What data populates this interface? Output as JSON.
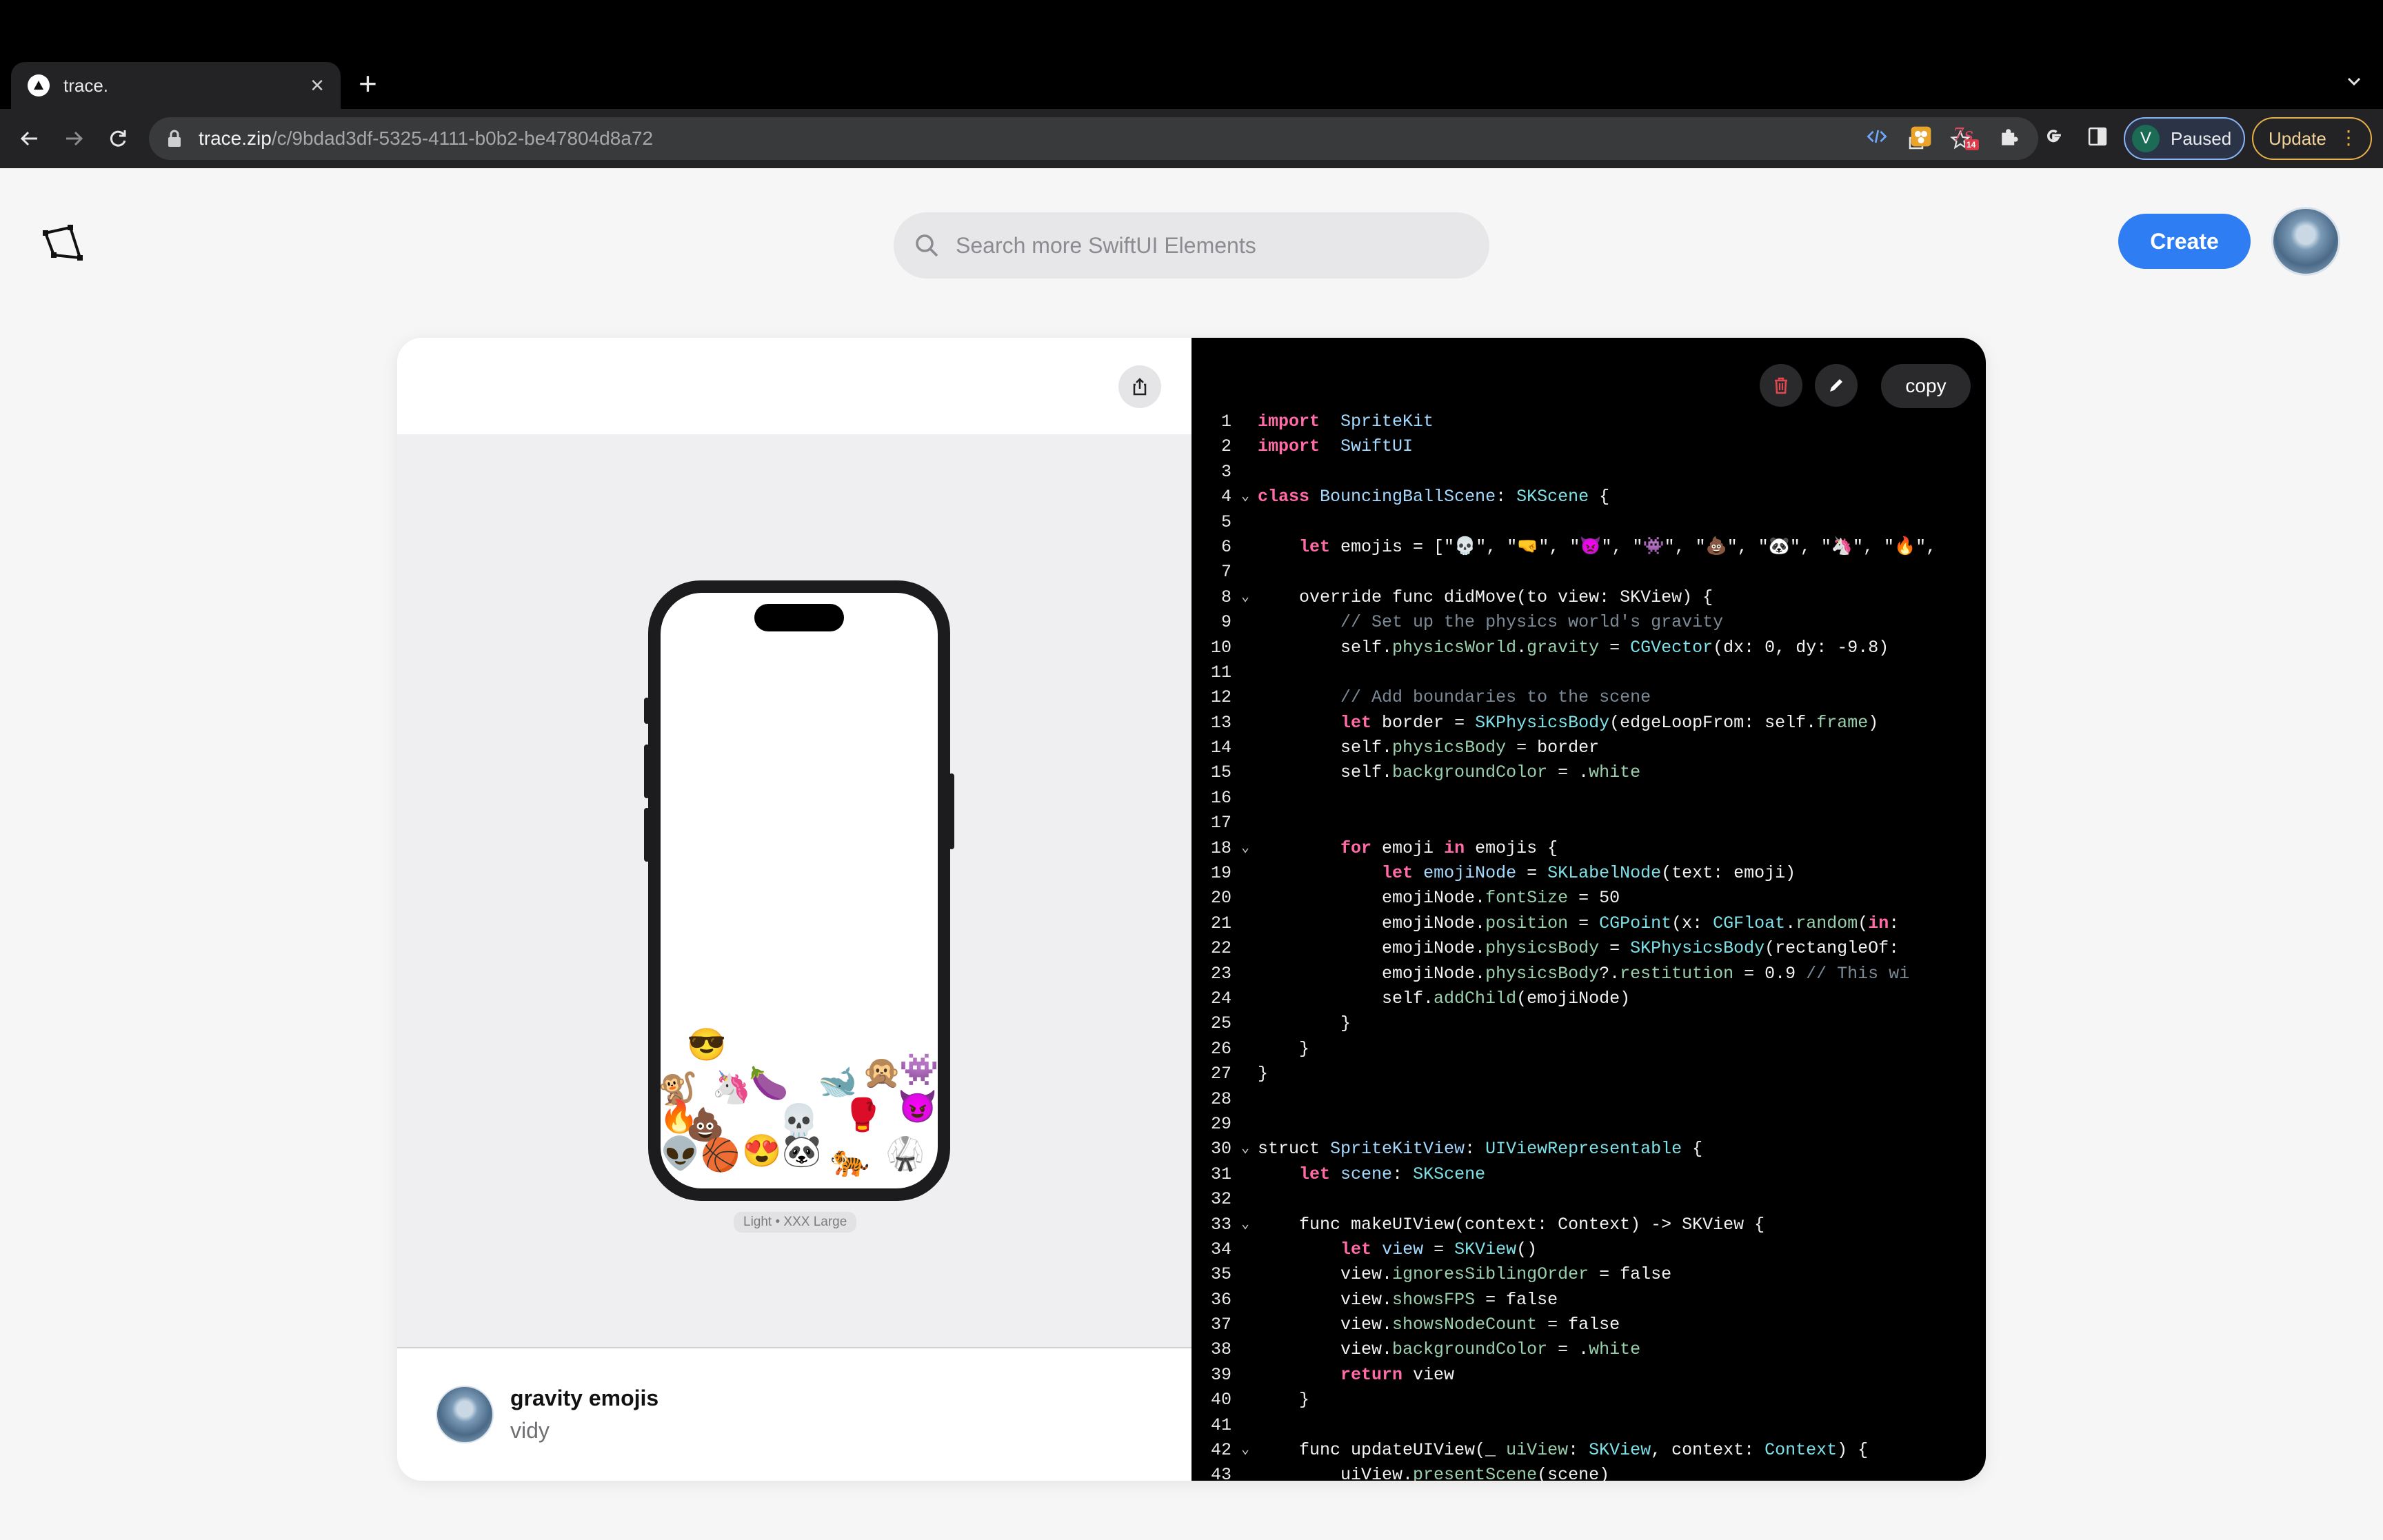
{
  "browser": {
    "tab_title": "trace.",
    "url_host": "trace.zip",
    "url_path": "/c/9bdad3df-5325-4111-b0b2-be47804d8a72",
    "profile_initial": "V",
    "profile_status": "Paused",
    "update_label": "Update",
    "extension_badge": "14"
  },
  "header": {
    "search_placeholder": "Search more SwiftUI Elements",
    "create_label": "Create"
  },
  "preview": {
    "variant_label": "Light • XXX Large",
    "emojis": [
      "😎",
      "🐒",
      "🦄",
      "🍆",
      "💀",
      "🐋",
      "🙊",
      "👾",
      "🔥",
      "💩",
      "🥊",
      "😈",
      "👽",
      "🏀",
      "😍",
      "🐼",
      "🐅",
      "🥋"
    ]
  },
  "element": {
    "title": "gravity emojis",
    "author": "vidy"
  },
  "code": {
    "copy_label": "copy",
    "lines": [
      {
        "n": "1",
        "fold": "",
        "t": [
          [
            "kw",
            "import"
          ],
          [
            "",
            "  "
          ],
          [
            "ty",
            "SpriteKit"
          ]
        ]
      },
      {
        "n": "2",
        "fold": "",
        "t": [
          [
            "kw",
            "import"
          ],
          [
            "",
            "  "
          ],
          [
            "ty",
            "SwiftUI"
          ]
        ]
      },
      {
        "n": "3",
        "fold": "",
        "t": []
      },
      {
        "n": "4",
        "fold": "⌄",
        "t": [
          [
            "kw",
            "class"
          ],
          [
            "",
            " "
          ],
          [
            "ty",
            "BouncingBallScene"
          ],
          [
            "",
            ": "
          ],
          [
            "tyc",
            "SKScene"
          ],
          [
            "",
            " {"
          ]
        ]
      },
      {
        "n": "5",
        "fold": "",
        "t": []
      },
      {
        "n": "6",
        "fold": "",
        "t": [
          [
            "",
            "    "
          ],
          [
            "kw",
            "let"
          ],
          [
            "",
            " emojis = [\"💀\", \"🤜\", \"👿\", \"👾\", \"💩\", \"🐼\", \"🦄\", \"🔥\","
          ]
        ]
      },
      {
        "n": "7",
        "fold": "",
        "t": []
      },
      {
        "n": "8",
        "fold": "⌄",
        "t": [
          [
            "",
            "    override func didMove(to view: SKView) {"
          ]
        ]
      },
      {
        "n": "9",
        "fold": "",
        "t": [
          [
            "",
            "        "
          ],
          [
            "cm",
            "// Set up the physics world's gravity"
          ]
        ]
      },
      {
        "n": "10",
        "fold": "",
        "t": [
          [
            "",
            "        self."
          ],
          [
            "pr",
            "physicsWorld"
          ],
          [
            "",
            "."
          ],
          [
            "pr",
            "gravity"
          ],
          [
            "",
            " = "
          ],
          [
            "tyc",
            "CGVector"
          ],
          [
            "",
            "(dx: 0, dy: -9.8)"
          ]
        ]
      },
      {
        "n": "11",
        "fold": "",
        "t": []
      },
      {
        "n": "12",
        "fold": "",
        "t": [
          [
            "",
            "        "
          ],
          [
            "cm",
            "// Add boundaries to the scene"
          ]
        ]
      },
      {
        "n": "13",
        "fold": "",
        "t": [
          [
            "",
            "        "
          ],
          [
            "kw",
            "let"
          ],
          [
            "",
            " border = "
          ],
          [
            "tyc",
            "SKPhysicsBody"
          ],
          [
            "",
            "(edgeLoopFrom: self."
          ],
          [
            "pr",
            "frame"
          ],
          [
            "",
            ")"
          ]
        ]
      },
      {
        "n": "14",
        "fold": "",
        "t": [
          [
            "",
            "        self."
          ],
          [
            "pr",
            "physicsBody"
          ],
          [
            "",
            " = border"
          ]
        ]
      },
      {
        "n": "15",
        "fold": "",
        "t": [
          [
            "",
            "        self."
          ],
          [
            "pr",
            "backgroundColor"
          ],
          [
            "",
            " = ."
          ],
          [
            "pr",
            "white"
          ]
        ]
      },
      {
        "n": "16",
        "fold": "",
        "t": []
      },
      {
        "n": "17",
        "fold": "",
        "t": []
      },
      {
        "n": "18",
        "fold": "⌄",
        "t": [
          [
            "",
            "        "
          ],
          [
            "kw",
            "for"
          ],
          [
            "",
            " emoji "
          ],
          [
            "kw",
            "in"
          ],
          [
            "",
            " emojis {"
          ]
        ]
      },
      {
        "n": "19",
        "fold": "",
        "t": [
          [
            "",
            "            "
          ],
          [
            "kw",
            "let"
          ],
          [
            "",
            " "
          ],
          [
            "ty",
            "emojiNode"
          ],
          [
            "",
            " = "
          ],
          [
            "tyc",
            "SKLabelNode"
          ],
          [
            "",
            "(text: emoji)"
          ]
        ]
      },
      {
        "n": "20",
        "fold": "",
        "t": [
          [
            "",
            "            emojiNode."
          ],
          [
            "pr",
            "fontSize"
          ],
          [
            "",
            " = 50"
          ]
        ]
      },
      {
        "n": "21",
        "fold": "",
        "t": [
          [
            "",
            "            emojiNode."
          ],
          [
            "pr",
            "position"
          ],
          [
            "",
            " = "
          ],
          [
            "tyc",
            "CGPoint"
          ],
          [
            "",
            "(x: "
          ],
          [
            "tyc",
            "CGFloat"
          ],
          [
            "",
            "."
          ],
          [
            "pr",
            "random"
          ],
          [
            "",
            "("
          ],
          [
            "kw",
            "in"
          ],
          [
            "",
            ":"
          ]
        ]
      },
      {
        "n": "22",
        "fold": "",
        "t": [
          [
            "",
            "            emojiNode."
          ],
          [
            "pr",
            "physicsBody"
          ],
          [
            "",
            " = "
          ],
          [
            "tyc",
            "SKPhysicsBody"
          ],
          [
            "",
            "(rectangleOf:"
          ]
        ]
      },
      {
        "n": "23",
        "fold": "",
        "t": [
          [
            "",
            "            emojiNode."
          ],
          [
            "pr",
            "physicsBody"
          ],
          [
            "",
            "?."
          ],
          [
            "pr",
            "restitution"
          ],
          [
            "",
            " = 0.9 "
          ],
          [
            "cm",
            "// This wi"
          ]
        ]
      },
      {
        "n": "24",
        "fold": "",
        "t": [
          [
            "",
            "            self."
          ],
          [
            "pr",
            "addChild"
          ],
          [
            "",
            "(emojiNode)"
          ]
        ]
      },
      {
        "n": "25",
        "fold": "",
        "t": [
          [
            "",
            "        }"
          ]
        ]
      },
      {
        "n": "26",
        "fold": "",
        "t": [
          [
            "",
            "    }"
          ]
        ]
      },
      {
        "n": "27",
        "fold": "",
        "t": [
          [
            "",
            "}"
          ]
        ]
      },
      {
        "n": "28",
        "fold": "",
        "t": []
      },
      {
        "n": "29",
        "fold": "",
        "t": []
      },
      {
        "n": "30",
        "fold": "⌄",
        "t": [
          [
            "",
            "struct "
          ],
          [
            "ty",
            "SpriteKitView"
          ],
          [
            "",
            ": "
          ],
          [
            "tyc",
            "UIViewRepresentable"
          ],
          [
            "",
            " {"
          ]
        ]
      },
      {
        "n": "31",
        "fold": "",
        "t": [
          [
            "",
            "    "
          ],
          [
            "kw",
            "let"
          ],
          [
            "",
            " "
          ],
          [
            "ty",
            "scene"
          ],
          [
            "",
            ": "
          ],
          [
            "tyc",
            "SKScene"
          ]
        ]
      },
      {
        "n": "32",
        "fold": "",
        "t": []
      },
      {
        "n": "33",
        "fold": "⌄",
        "t": [
          [
            "",
            "    func makeUIView(context: Context) -> SKView {"
          ]
        ]
      },
      {
        "n": "34",
        "fold": "",
        "t": [
          [
            "",
            "        "
          ],
          [
            "kw",
            "let"
          ],
          [
            "",
            " "
          ],
          [
            "ty",
            "view"
          ],
          [
            "",
            " = "
          ],
          [
            "tyc",
            "SKView"
          ],
          [
            "",
            "()"
          ]
        ]
      },
      {
        "n": "35",
        "fold": "",
        "t": [
          [
            "",
            "        view."
          ],
          [
            "pr",
            "ignoresSiblingOrder"
          ],
          [
            "",
            " = false"
          ]
        ]
      },
      {
        "n": "36",
        "fold": "",
        "t": [
          [
            "",
            "        view."
          ],
          [
            "pr",
            "showsFPS"
          ],
          [
            "",
            " = false"
          ]
        ]
      },
      {
        "n": "37",
        "fold": "",
        "t": [
          [
            "",
            "        view."
          ],
          [
            "pr",
            "showsNodeCount"
          ],
          [
            "",
            " = false"
          ]
        ]
      },
      {
        "n": "38",
        "fold": "",
        "t": [
          [
            "",
            "        view."
          ],
          [
            "pr",
            "backgroundColor"
          ],
          [
            "",
            " = ."
          ],
          [
            "pr",
            "white"
          ]
        ]
      },
      {
        "n": "39",
        "fold": "",
        "t": [
          [
            "",
            "        "
          ],
          [
            "kw",
            "return"
          ],
          [
            "",
            " view"
          ]
        ]
      },
      {
        "n": "40",
        "fold": "",
        "t": [
          [
            "",
            "    }"
          ]
        ]
      },
      {
        "n": "41",
        "fold": "",
        "t": []
      },
      {
        "n": "42",
        "fold": "⌄",
        "t": [
          [
            "",
            "    func updateUIView(_ "
          ],
          [
            "pr",
            "uiView"
          ],
          [
            "",
            ": "
          ],
          [
            "tyc",
            "SKView"
          ],
          [
            "",
            ", context: "
          ],
          [
            "tyc",
            "Context"
          ],
          [
            "",
            ") {"
          ]
        ]
      },
      {
        "n": "43",
        "fold": "",
        "t": [
          [
            "",
            "        uiView."
          ],
          [
            "pr",
            "presentScene"
          ],
          [
            "",
            "(scene)"
          ]
        ]
      }
    ]
  },
  "colors": {
    "accent": "#2f7df3",
    "code_keyword": "#ff6aa7",
    "code_type": "#a4d9ff",
    "code_property": "#9bd0ae",
    "code_comment": "#7c8b97",
    "delete_icon": "#e0484f"
  }
}
